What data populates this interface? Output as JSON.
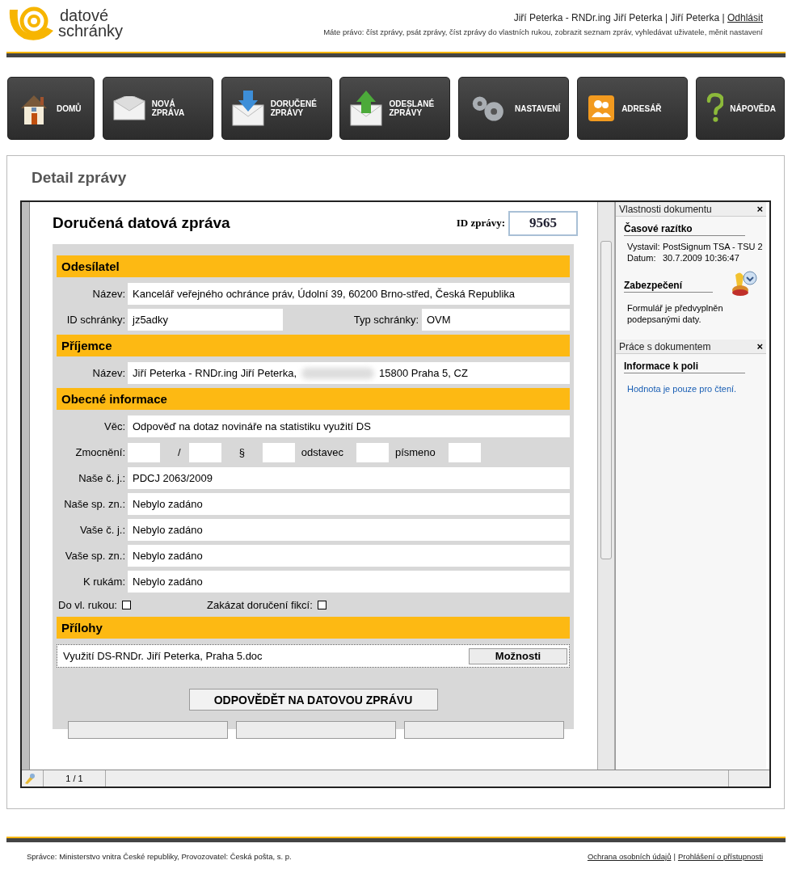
{
  "header": {
    "logo": {
      "line1": "datové",
      "line2": "schránky"
    },
    "user_text": "Jiří Peterka - RNDr.ing Jiří Peterka | Jiří Peterka |",
    "logout": "Odhlásit",
    "rights": "Máte právo: číst zprávy, psát zprávy, číst zprávy do vlastních rukou, zobrazit seznam zpráv, vyhledávat uživatele, měnit nastavení"
  },
  "nav": [
    {
      "label": "DOMŮ"
    },
    {
      "label": "NOVÁ ZPRÁVA"
    },
    {
      "label": "DORUČENÉ ZPRÁVY"
    },
    {
      "label": "ODESLANÉ ZPRÁVY"
    },
    {
      "label": "NASTAVENÍ"
    },
    {
      "label": "ADRESÁŘ"
    },
    {
      "label": "NÁPOVĚDA"
    }
  ],
  "page_title": "Detail zprávy",
  "document": {
    "title": "Doručená datová zpráva",
    "id_label": "ID zprávy:",
    "id_value": "9565",
    "sections": [
      {
        "heading": "Odesílatel",
        "rows": [
          {
            "kind": "full",
            "label": "Název:",
            "value": "Kancelář veřejného ochránce práv, Údolní 39, 60200 Brno-střed, Česká Republika"
          },
          {
            "kind": "pair",
            "label": "ID schránky:",
            "value": "jz5adky",
            "label2": "Typ schránky:",
            "value2": "OVM"
          }
        ]
      },
      {
        "heading": "Příjemce",
        "rows": [
          {
            "kind": "redacted",
            "label": "Název:",
            "value": "Jiří Peterka - RNDr.ing Jiří Peterka,",
            "value_after": "15800 Praha 5, CZ"
          }
        ]
      },
      {
        "heading": "Obecné informace",
        "rows": [
          {
            "kind": "full",
            "label": "Věc:",
            "value": "Odpověď na dotaz novináře na statistiku využití DS"
          },
          {
            "kind": "mandate",
            "label": "Zmocnění:",
            "parts": [
              "/",
              "§",
              "odstavec",
              "písmeno"
            ]
          },
          {
            "kind": "full",
            "label": "Naše č. j.:",
            "value": "PDCJ 2063/2009"
          },
          {
            "kind": "full",
            "label": "Naše sp. zn.:",
            "value": "Nebylo zadáno"
          },
          {
            "kind": "full",
            "label": "Vaše č. j.:",
            "value": "Nebylo zadáno"
          },
          {
            "kind": "full",
            "label": "Vaše sp. zn.:",
            "value": "Nebylo zadáno"
          },
          {
            "kind": "full",
            "label": "K rukám:",
            "value": "Nebylo zadáno"
          },
          {
            "kind": "checks",
            "items": [
              {
                "label": "Do vl. rukou:",
                "checked": false
              },
              {
                "label": "Zakázat doručení fikcí:",
                "checked": false
              }
            ]
          }
        ]
      },
      {
        "heading": "Přílohy",
        "rows": [
          {
            "kind": "attachment",
            "value": "Využití DS-RNDr. Jiří Peterka, Praha 5.doc",
            "button": "Možnosti"
          }
        ]
      }
    ],
    "reply_button": "ODPOVĚDĚT NA DATOVOU ZPRÁVU"
  },
  "side_panels": [
    {
      "title": "Vlastnosti dokumentu",
      "close": "×",
      "blocks": [
        {
          "kind": "kv",
          "heading": "Časové razítko",
          "rows": [
            {
              "k": "Vystavil:",
              "v": "PostSignum TSA - TSU 2"
            },
            {
              "k": "Datum:",
              "v": "30.7.2009 10:36:47"
            }
          ]
        },
        {
          "kind": "stamp",
          "heading": "Zabezpečení",
          "text": "Formulář je předvyplněn podepsanými daty."
        }
      ]
    },
    {
      "title": "Práce s dokumentem",
      "close": "×",
      "blocks": [
        {
          "kind": "info",
          "heading": "Informace k poli",
          "text": "Hodnota je pouze pro čtení."
        }
      ]
    }
  ],
  "status_bar": {
    "page": "1 / 1"
  },
  "footer": {
    "text": "Správce: Ministerstvo vnitra České republiky, Provozovatel: Česká pošta, s. p.",
    "links": [
      "Ochrana osobních údajů",
      "Prohlášení o přístupnosti"
    ],
    "separator": "|"
  }
}
